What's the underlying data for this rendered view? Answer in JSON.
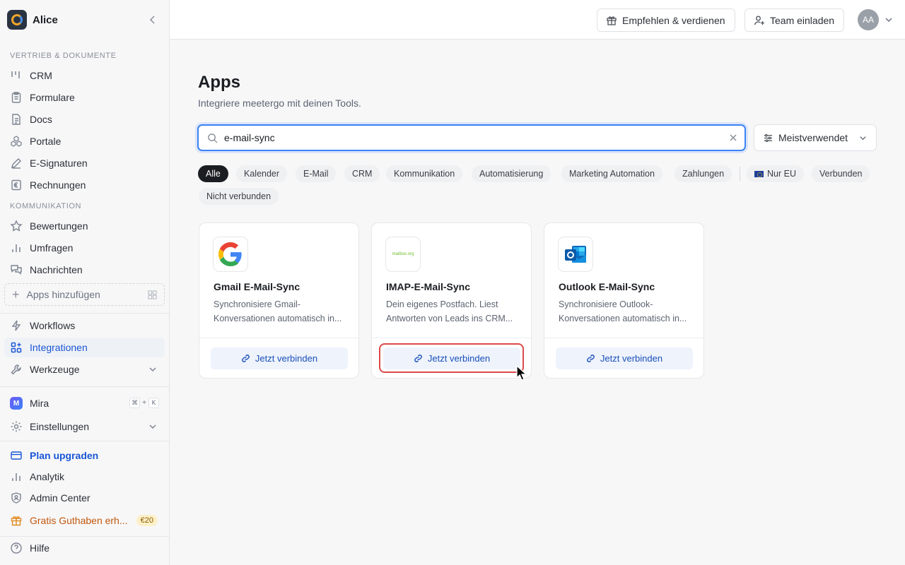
{
  "workspace": {
    "name": "Alice"
  },
  "sidebar": {
    "section_sales": "VERTRIEB & DOKUMENTE",
    "sales_items": [
      {
        "label": "CRM",
        "icon": "kanban-icon"
      },
      {
        "label": "Formulare",
        "icon": "clipboard-icon"
      },
      {
        "label": "Docs",
        "icon": "document-icon"
      },
      {
        "label": "Portale",
        "icon": "boxes-icon"
      },
      {
        "label": "E-Signaturen",
        "icon": "pen-icon"
      },
      {
        "label": "Rechnungen",
        "icon": "euro-receipt-icon"
      }
    ],
    "section_comm": "KOMMUNIKATION",
    "comm_items": [
      {
        "label": "Bewertungen",
        "icon": "star-icon"
      },
      {
        "label": "Umfragen",
        "icon": "bar-chart-icon"
      },
      {
        "label": "Nachrichten",
        "icon": "chat-icon"
      }
    ],
    "add_apps": "Apps hinzufügen",
    "workflows": "Workflows",
    "integrations": "Integrationen",
    "tools": "Werkzeuge",
    "mira": "Mira",
    "mira_shortcut": [
      "⌘",
      "+",
      "K"
    ],
    "settings": "Einstellungen",
    "upgrade": "Plan upgraden",
    "analytics": "Analytik",
    "admin": "Admin Center",
    "credit": "Gratis Guthaben erh...",
    "credit_badge": "€20",
    "help": "Hilfe"
  },
  "topbar": {
    "refer": "Empfehlen & verdienen",
    "invite": "Team einladen",
    "avatar_initials": "AA"
  },
  "main": {
    "title": "Apps",
    "subtitle": "Integriere meetergo mit deinen Tools.",
    "search_value": "e-mail-sync",
    "sort_label": "Meistverwendet",
    "filters": [
      "Alle",
      "Kalender",
      "E-Mail",
      "CRM",
      "Kommunikation",
      "Automatisierung",
      "Marketing Automation",
      "Zahlungen"
    ],
    "filters_right": [
      "Nur EU",
      "Verbunden"
    ],
    "filters_row2": [
      "Nicht verbunden"
    ],
    "active_filter": "Alle"
  },
  "cards": [
    {
      "title": "Gmail E-Mail-Sync",
      "desc": "Synchronisiere Gmail-Konversationen automatisch in...",
      "button": "Jetzt verbinden",
      "logo": "google-logo"
    },
    {
      "title": "IMAP-E-Mail-Sync",
      "desc": "Dein eigenes Postfach. Liest Antworten von Leads ins CRM...",
      "button": "Jetzt verbinden",
      "logo": "mailbox-org-logo",
      "logo_text": "mailbox.org"
    },
    {
      "title": "Outlook E-Mail-Sync",
      "desc": "Synchronisiere Outlook-Konversationen automatisch in...",
      "button": "Jetzt verbinden",
      "logo": "outlook-logo"
    }
  ],
  "colors": {
    "accent": "#1a56d6",
    "focus": "#3b82f6",
    "highlight": "#dc4a4a",
    "warning": "#c2570c"
  }
}
